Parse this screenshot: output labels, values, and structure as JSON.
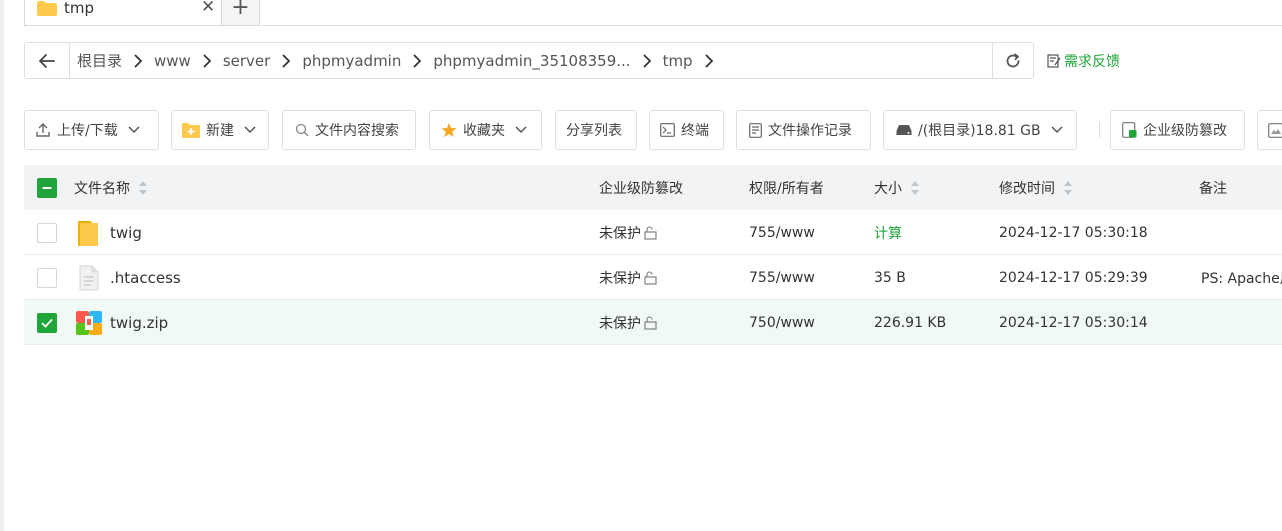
{
  "tab": {
    "title": "tmp",
    "close_glyph": "✕",
    "add_glyph": "+"
  },
  "breadcrumb": {
    "items": [
      "根目录",
      "www",
      "server",
      "phpmyadmin",
      "phpmyadmin_35108359...",
      "tmp"
    ]
  },
  "feedback_label": "需求反馈",
  "toolbar": {
    "upload_label": "上传/下载",
    "new_label": "新建",
    "search_label": "文件内容搜索",
    "favorites_label": "收藏夹",
    "share_label": "分享列表",
    "terminal_label": "终端",
    "oplog_label": "文件操作记录",
    "disk_label": "/(根目录)18.81 GB",
    "tamper_label": "企业级防篡改"
  },
  "table": {
    "headers": {
      "name": "文件名称",
      "tamper": "企业级防篡改",
      "perm": "权限/所有者",
      "size": "大小",
      "mtime": "修改时间",
      "note": "备注"
    },
    "rows": [
      {
        "name": "twig",
        "type": "folder",
        "tamper": "未保护",
        "perm": "755/www",
        "size": "计算",
        "mtime": "2024-12-17 05:30:18",
        "note": "",
        "checked": false
      },
      {
        "name": ".htaccess",
        "type": "file",
        "tamper": "未保护",
        "perm": "755/www",
        "size": "35 B",
        "mtime": "2024-12-17 05:29:39",
        "note": "PS: Apache用户",
        "checked": false
      },
      {
        "name": "twig.zip",
        "type": "zip",
        "tamper": "未保护",
        "perm": "750/www",
        "size": "226.91 KB",
        "mtime": "2024-12-17 05:30:14",
        "note": "",
        "checked": true
      }
    ]
  },
  "colors": {
    "accent": "#20a53a",
    "folder": "#ffc94d",
    "selected_row": "#f0f9f3"
  }
}
